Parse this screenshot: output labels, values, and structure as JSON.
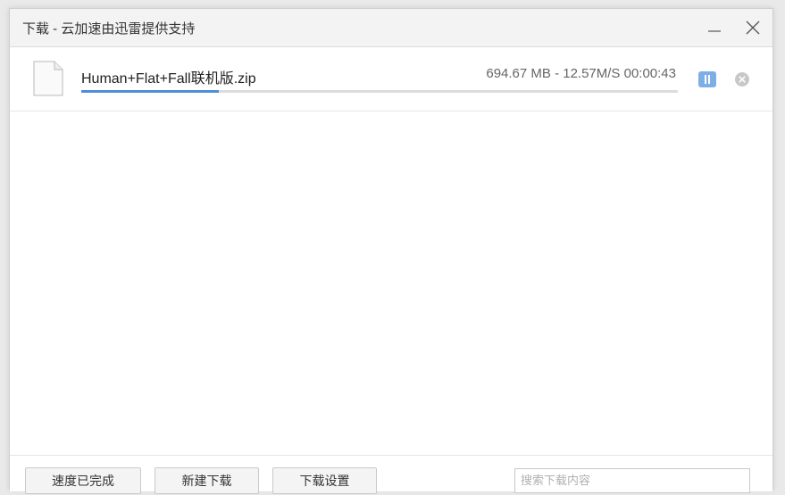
{
  "window": {
    "title": "下载 - 云加速由迅雷提供支持"
  },
  "download": {
    "file_name": "Human+Flat+Fall联机版.zip",
    "status": "694.67 MB - 12.57M/S 00:00:43",
    "progress_fraction": 0.23
  },
  "footer": {
    "button_1": "速度已完成",
    "button_2": "新建下载",
    "button_3": "下载设置",
    "search_placeholder": "搜索下载内容"
  },
  "colors": {
    "progress": "#4d8fd6",
    "pause_button": "#7eaee6"
  },
  "icons": {
    "file": "file-icon",
    "pause": "pause-icon",
    "cancel": "close-circle-icon",
    "minimize": "minimize-icon",
    "close": "close-icon"
  }
}
